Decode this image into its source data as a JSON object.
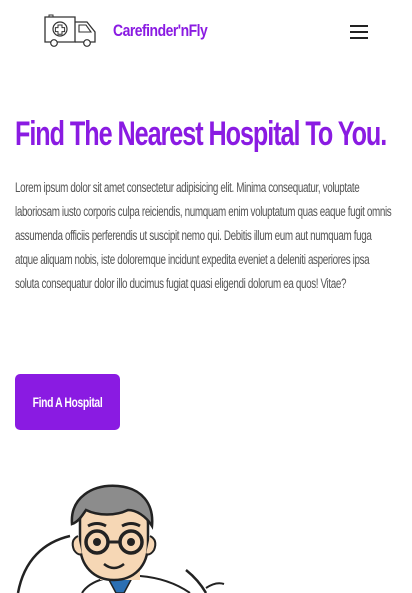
{
  "brand": {
    "name": "Carefinder'nFly",
    "logo_icon": "ambulance-icon"
  },
  "nav": {
    "menu_icon": "hamburger-menu-icon"
  },
  "hero": {
    "title": "Find The Nearest Hospital To You.",
    "body": "Lorem ipsum dolor sit amet consectetur adipisicing elit. Minima consequatur, voluptate laboriosam iusto corporis culpa reiciendis, numquam enim voluptatum quas eaque fugit omnis assumenda officiis perferendis ut suscipit nemo qui. Debitis illum eum aut numquam fuga atque aliquam nobis, iste doloremque incidunt expedita eveniet a deleniti asperiores ipsa soluta consequatur dolor illo ducimus fugiat quasi eligendi dolorum ea quos! Vitae?",
    "cta_label": "Find A Hospital"
  },
  "colors": {
    "accent": "#8a1be2",
    "body_text": "#555555"
  }
}
